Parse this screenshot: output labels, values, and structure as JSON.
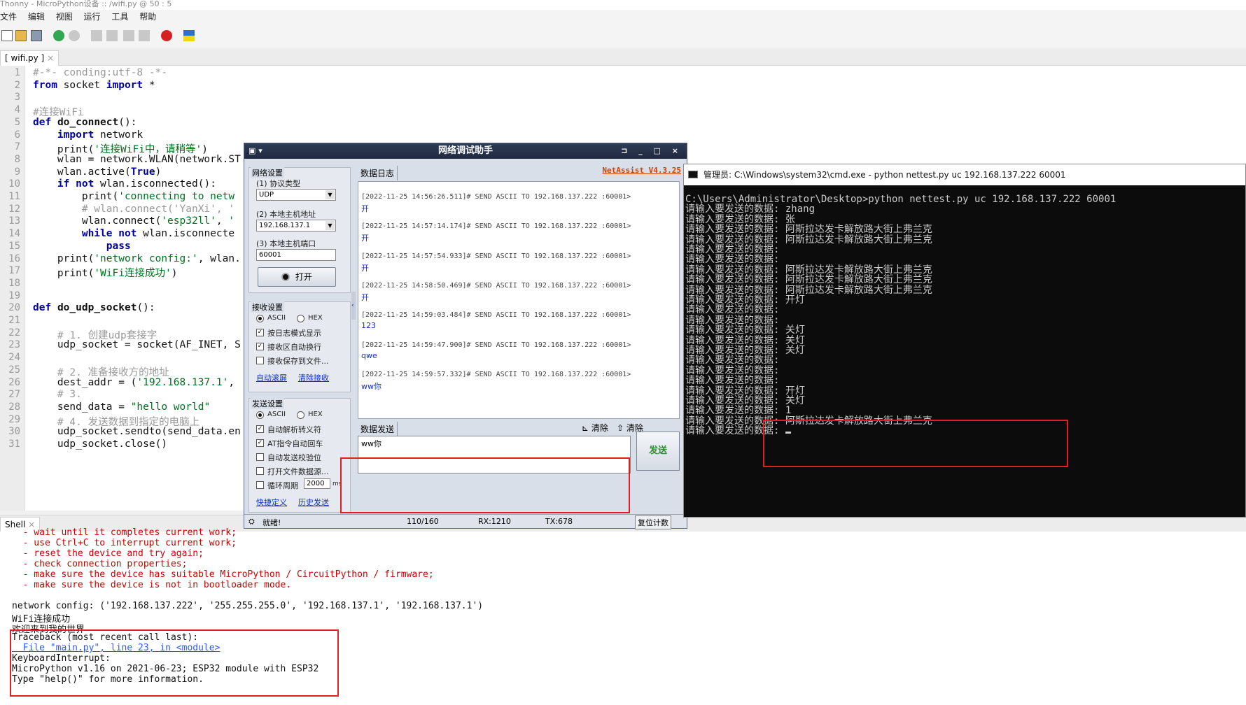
{
  "thonny": {
    "title": "Thonny  -  MicroPython设备 :: /wifi.py  @  50 : 5",
    "menu": [
      "文件",
      "编辑",
      "视图",
      "运行",
      "工具",
      "帮助"
    ],
    "tab": "[ wifi.py ]",
    "shell_tab": "Shell",
    "code_lines": [
      "#-*- conding:utf-8 -*-",
      "from socket import *",
      "",
      "#连接WiFi",
      "def do_connect():",
      "    import network",
      "    print('连接WiFi中，请稍等')",
      "    wlan = network.WLAN(network.ST",
      "    wlan.active(True)",
      "    if not wlan.isconnected():",
      "        print('connecting to netw",
      "        # wlan.connect('YanXi', '",
      "        wlan.connect('esp32ll', '",
      "        while not wlan.isconnecte",
      "            pass",
      "    print('network config:', wlan.",
      "    print('WiFi连接成功')",
      "",
      "",
      "def do_udp_socket():",
      "",
      "    # 1. 创建udp套接字",
      "    udp_socket = socket(AF_INET, S",
      "",
      "    # 2. 准备接收方的地址",
      "    dest_addr = ('192.168.137.1',",
      "    # 3.",
      "    send_data = \"hello world\"",
      "    # 4. 发送数据到指定的电脑上",
      "    udp_socket.sendto(send_data.en",
      "    udp_socket.close()"
    ],
    "shell_lines": [
      {
        "t": "  - wait until it completes current work;",
        "c": "err"
      },
      {
        "t": "  - use Ctrl+C to interrupt current work;",
        "c": "err"
      },
      {
        "t": "  - reset the device and try again;",
        "c": "err"
      },
      {
        "t": "  - check connection properties;",
        "c": "err"
      },
      {
        "t": "  - make sure the device has suitable MicroPython / CircuitPython / firmware;",
        "c": "err"
      },
      {
        "t": "  - make sure the device is not in bootloader mode.",
        "c": "err"
      },
      {
        "t": "",
        "c": ""
      },
      {
        "t": "network config: ('192.168.137.222', '255.255.255.0', '192.168.137.1', '192.168.137.1')",
        "c": ""
      },
      {
        "t": "WiFi连接成功",
        "c": ""
      },
      {
        "t": "欢迎来到我的世界",
        "c": ""
      },
      {
        "t": "Traceback (most recent call last):",
        "c": ""
      },
      {
        "t": "  File \"main.py\", line 23, in <module>",
        "c": "lnk"
      },
      {
        "t": "KeyboardInterrupt:",
        "c": ""
      },
      {
        "t": "MicroPython v1.16 on 2021-06-23; ESP32 module with ESP32",
        "c": ""
      },
      {
        "t": "Type \"help()\" for more information.",
        "c": ""
      }
    ]
  },
  "netassist": {
    "title": "网络调试助手",
    "brand": "NetAssist V4.3.25",
    "net_settings": "网络设置",
    "protocol_label": "(1) 协议类型",
    "protocol_value": "UDP",
    "host_label": "(2) 本地主机地址",
    "host_value": "192.168.137.1",
    "port_label": "(3) 本地主机端口",
    "port_value": "60001",
    "open_button": "打开",
    "recv_settings": "接收设置",
    "ascii": "ASCII",
    "hex": "HEX",
    "recv_opt1": "按日志模式显示",
    "recv_opt2": "接收区自动换行",
    "recv_opt3": "接收保存到文件...",
    "auto_scroll": "自动滚屏",
    "clear_recv": "清除接收",
    "send_settings": "发送设置",
    "send_opt1": "自动解析转义符",
    "send_opt2": "AT指令自动回车",
    "send_opt3": "自动发送校验位",
    "send_opt4": "打开文件数据源...",
    "send_opt5": "循环周期",
    "cycle_value": "2000",
    "cycle_unit": "ms",
    "quick_def": "快捷定义",
    "history_send": "历史发送",
    "data_log_tab": "数据日志",
    "data_send_tab": "数据发送",
    "clear1": "清除",
    "clear2": "清除",
    "send_text": "ww你",
    "send_button": "发送",
    "status_ready": "就绪!",
    "status_count": "110/160",
    "status_rx": "RX:1210",
    "status_tx": "TX:678",
    "reset_count": "复位计数",
    "log": [
      {
        "h": "[2022-11-25 14:56:26.511]# SEND ASCII TO 192.168.137.222 :60001>",
        "v": "开"
      },
      {
        "h": "[2022-11-25 14:57:14.174]# SEND ASCII TO 192.168.137.222 :60001>",
        "v": "开"
      },
      {
        "h": "[2022-11-25 14:57:54.933]# SEND ASCII TO 192.168.137.222 :60001>",
        "v": "开"
      },
      {
        "h": "[2022-11-25 14:58:50.469]# SEND ASCII TO 192.168.137.222 :60001>",
        "v": "开"
      },
      {
        "h": "[2022-11-25 14:59:03.484]# SEND ASCII TO 192.168.137.222 :60001>",
        "v": "123"
      },
      {
        "h": "[2022-11-25 14:59:47.900]# SEND ASCII TO 192.168.137.222 :60001>",
        "v": "qwe"
      },
      {
        "h": "[2022-11-25 14:59:57.332]# SEND ASCII TO 192.168.137.222 :60001>",
        "v": "ww你"
      }
    ]
  },
  "cmd": {
    "title": "管理员: C:\\Windows\\system32\\cmd.exe - python  nettest.py uc 192.168.137.222 60001",
    "lines": [
      "C:\\Users\\Administrator\\Desktop>python nettest.py uc 192.168.137.222 60001",
      "请输入要发送的数据: zhang",
      "请输入要发送的数据: 张",
      "请输入要发送的数据: 阿斯拉达发卡解放路大街上弗兰克",
      "请输入要发送的数据: 阿斯拉达发卡解放路大街上弗兰克",
      "请输入要发送的数据:",
      "请输入要发送的数据:",
      "请输入要发送的数据: 阿斯拉达发卡解放路大街上弗兰克",
      "请输入要发送的数据: 阿斯拉达发卡解放路大街上弗兰克",
      "请输入要发送的数据: 阿斯拉达发卡解放路大街上弗兰克",
      "请输入要发送的数据: 开灯",
      "请输入要发送的数据:",
      "请输入要发送的数据:",
      "请输入要发送的数据: 关灯",
      "请输入要发送的数据: 关灯",
      "请输入要发送的数据: 关灯",
      "请输入要发送的数据:",
      "请输入要发送的数据:",
      "请输入要发送的数据:",
      "请输入要发送的数据: 开灯",
      "请输入要发送的数据: 关灯",
      "请输入要发送的数据: 1",
      "请输入要发送的数据: 阿斯拉达发卡解放路大街上弗兰克",
      "请输入要发送的数据: "
    ]
  }
}
